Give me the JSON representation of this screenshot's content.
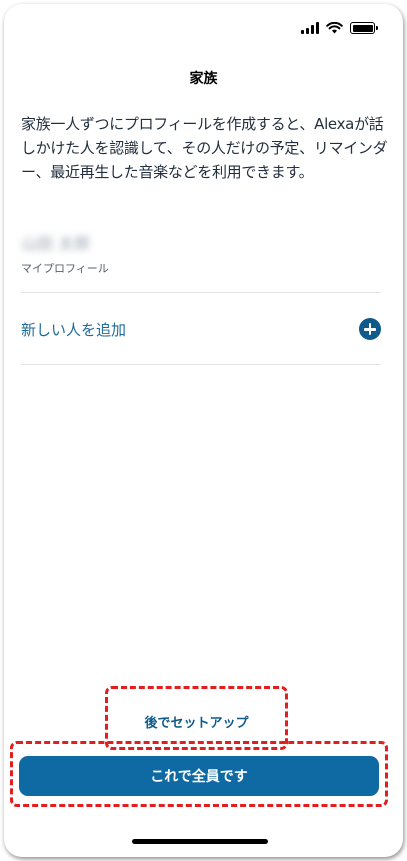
{
  "header": {
    "title": "家族"
  },
  "description": "家族一人ずつにプロフィールを作成すると、Alexaが話しかけた人を認識して、その人だけの予定、リマインダー、最近再生した音楽などを利用できます。",
  "profile": {
    "name": "山田 太郎",
    "subtitle": "マイプロフィール"
  },
  "add_person": {
    "label": "新しい人を追加"
  },
  "buttons": {
    "later": "後でセットアップ",
    "done": "これで全員です"
  },
  "colors": {
    "accent": "#0f6aa4",
    "link": "#1e6b9a",
    "highlight": "#e21e1e",
    "text": "#232f3e"
  }
}
